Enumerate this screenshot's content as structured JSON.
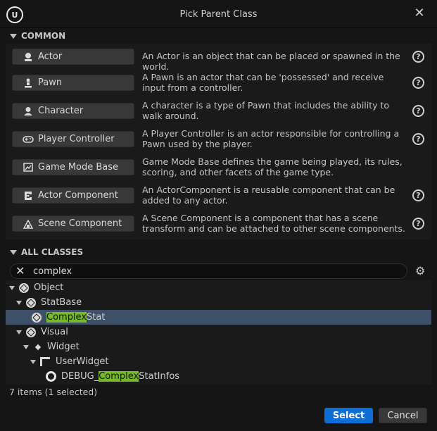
{
  "window": {
    "title": "Pick Parent Class"
  },
  "common": {
    "header": "COMMON",
    "items": [
      {
        "label": "Actor",
        "icon": "actor-icon",
        "desc": "An Actor is an object that can be placed or spawned in the world.",
        "help": "?"
      },
      {
        "label": "Pawn",
        "icon": "pawn-icon",
        "desc": "A Pawn is an actor that can be 'possessed' and receive input from a controller.",
        "help": "?"
      },
      {
        "label": "Character",
        "icon": "character-icon",
        "desc": "A character is a type of Pawn that includes the ability to walk around.",
        "help": "?"
      },
      {
        "label": "Player Controller",
        "icon": "gamepad-icon",
        "desc": "A Player Controller is an actor responsible for controlling a Pawn used by the player.",
        "help": "?"
      },
      {
        "label": "Game Mode Base",
        "icon": "game-mode-icon",
        "desc": "Game Mode Base defines the game being played, its rules, scoring, and other facets of the game type.",
        "help": ""
      },
      {
        "label": "Actor Component",
        "icon": "actor-component-icon",
        "desc": "An ActorComponent is a reusable component that can be added to any actor.",
        "help": "?"
      },
      {
        "label": "Scene Component",
        "icon": "scene-component-icon",
        "desc": "A Scene Component is a component that has a scene transform and can be attached to other scene components.",
        "help": "?"
      }
    ]
  },
  "all_classes": {
    "header": "ALL CLASSES",
    "search": {
      "value": "complex"
    },
    "tree": [
      {
        "label": "Object",
        "depth": 0
      },
      {
        "label": "StatBase",
        "depth": 1
      },
      {
        "pre": "",
        "match": "Complex",
        "post": "Stat",
        "depth": 2,
        "selected": true
      },
      {
        "label": "Visual",
        "depth": 1
      },
      {
        "label": "Widget",
        "depth": 2
      },
      {
        "label": "UserWidget",
        "depth": 3
      },
      {
        "pre": "DEBUG_",
        "match": "Complex",
        "post": "StatInfos",
        "depth": 4
      }
    ]
  },
  "status": {
    "text": "7 items (1 selected)"
  },
  "buttons": {
    "select": "Select",
    "cancel": "Cancel"
  },
  "colors": {
    "accent": "#0d6fd6",
    "highlight": "#76b82a",
    "selection": "#3e5068"
  }
}
